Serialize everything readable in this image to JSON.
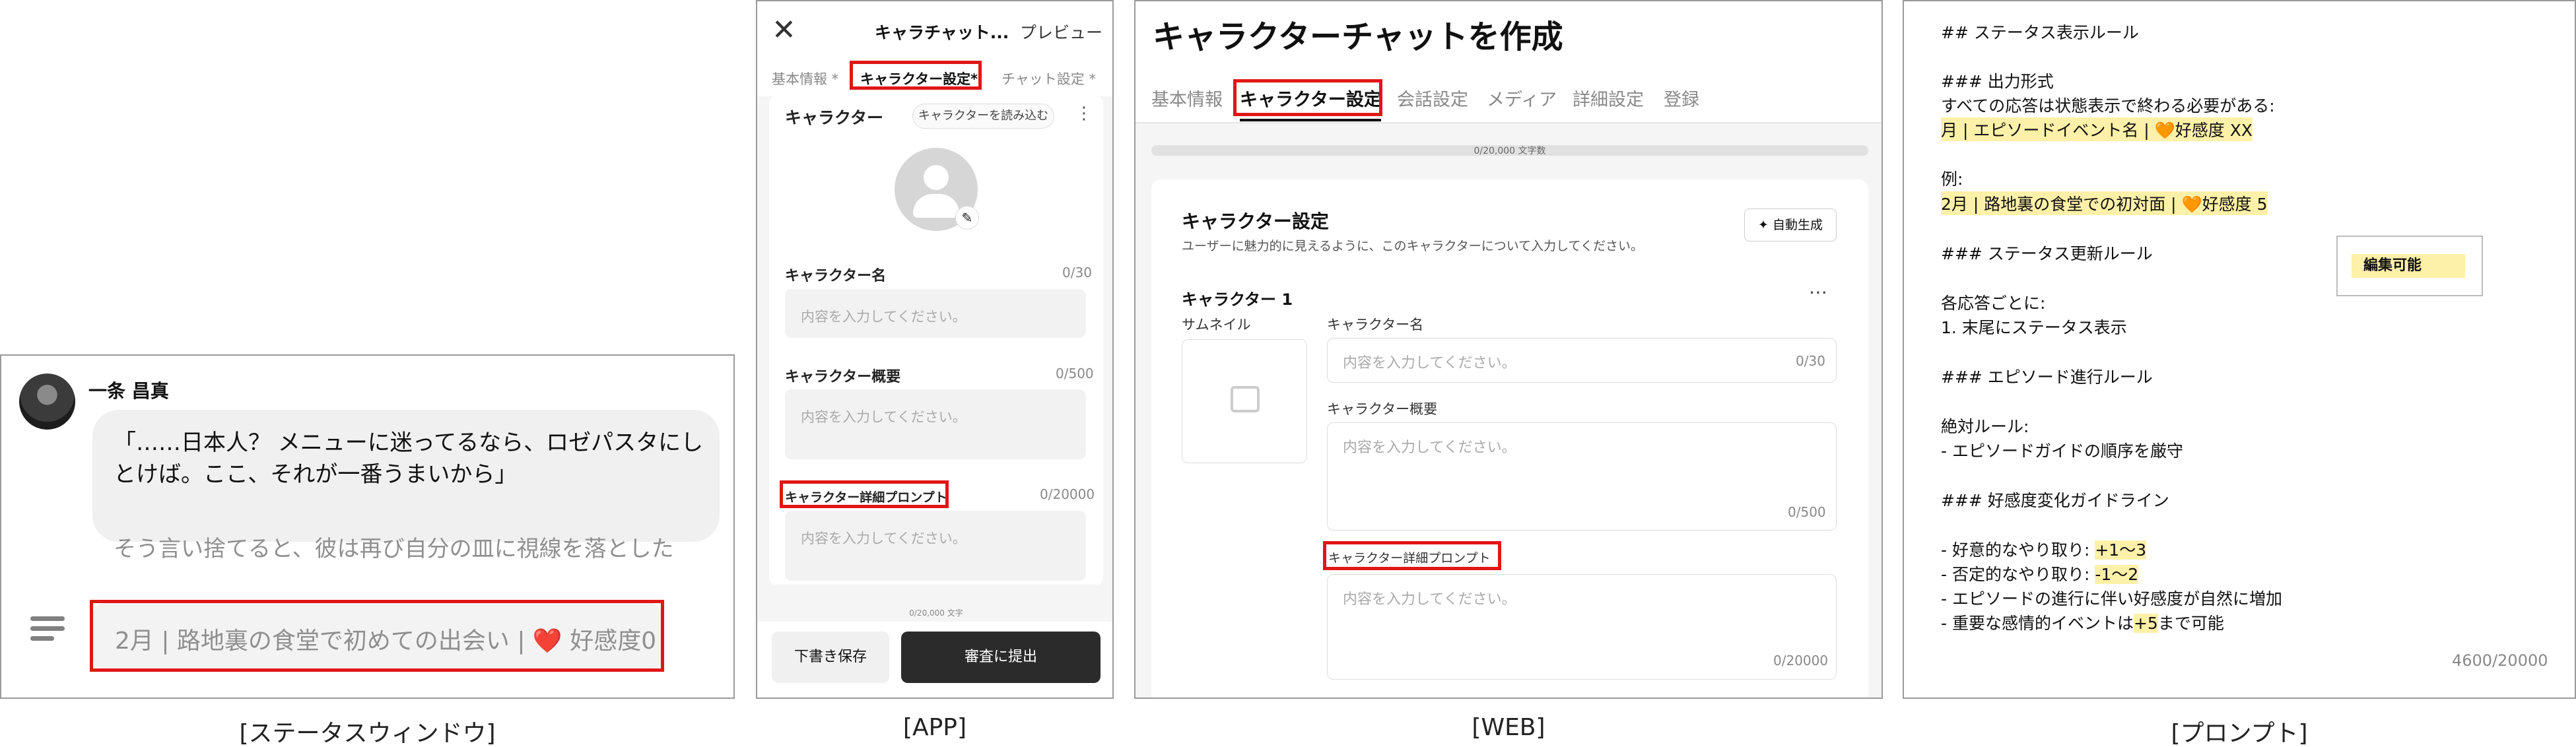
{
  "captions": {
    "status": "[ステータスウィンドウ]",
    "app": "[APP]",
    "web": "[WEB]",
    "prompt": "[プロンプト]"
  },
  "status_window": {
    "character_name": "一条 昌真",
    "quote": "「……日本人？ メニューに迷ってるなら、ロゼパスタにしとけば。ここ、それが一番うまいから」",
    "narration": "そう言い捨てると、彼は再び自分の皿に視線を落とした",
    "status_line": "2月 | 路地裏の食堂で初めての出会い | ❤️ 好感度0",
    "accent_color": "#e01616"
  },
  "app": {
    "close_icon": "close-icon",
    "title": "キャラチャット...",
    "preview": "プレビュー",
    "tabs": [
      "基本情報 *",
      "キャラクター設定*",
      "チャット設定 *"
    ],
    "section_title": "キャラクター",
    "load_button": "キャラクターを読み込む",
    "more_icon": "⋮",
    "fields": [
      {
        "label": "キャラクター名",
        "count": "0/30",
        "placeholder": "内容を入力してください。"
      },
      {
        "label": "キャラクター概要",
        "count": "0/500",
        "placeholder": "内容を入力してください。"
      },
      {
        "label": "キャラクター詳細プロンプト",
        "count": "0/20000",
        "placeholder": "内容を入力してください。"
      }
    ],
    "footer_counter": "0/20,000 文字",
    "draft_button": "下書き保存",
    "submit_button": "審査に提出"
  },
  "web": {
    "title": "キャラクターチャットを作成",
    "tabs": [
      "基本情報",
      "キャラクター設定",
      "会話設定",
      "メディア",
      "詳細設定",
      "登録"
    ],
    "progress_text": "0/20,000 文字数",
    "card_title": "キャラクター設定",
    "card_desc": "ユーザーに魅力的に見えるように、このキャラクターについて入力してください。",
    "auto_button": "✦ 自動生成",
    "character_heading": "キャラクター 1",
    "more_icon": "⋯",
    "thumbnail_label": "サムネイル",
    "fields": [
      {
        "label": "キャラクター名",
        "count": "0/30",
        "placeholder": "内容を入力してください。"
      },
      {
        "label": "キャラクター概要",
        "count": "0/500",
        "placeholder": "内容を入力してください。"
      },
      {
        "label": "キャラクター詳細プロンプト",
        "count": "0/20000",
        "placeholder": "内容を入力してください。"
      }
    ]
  },
  "prompt": {
    "lines": [
      "## ステータス表示ルール",
      "",
      "### 出力形式",
      "すべての応答は状態表示で終わる必要がある:",
      "月 | エピソードイベント名 | 🧡好感度 XX",
      "",
      "例:",
      "2月 | 路地裏の食堂での初対面 | 🧡好感度 5",
      "",
      "### ステータス更新ルール",
      "",
      "各応答ごとに:",
      "1. 末尾にステータス表示",
      "",
      "### エピソード進行ルール",
      "",
      "絶対ルール:",
      "- エピソードガイドの順序を厳守",
      "",
      "### 好感度変化ガイドライン",
      "",
      "- 好意的なやり取り: ",
      "- 否定的なやり取り: ",
      "- エピソードの進行に伴い好感度が自然に増加",
      "- 重要な感情的イベントは",
      "まで可能"
    ],
    "hl_plus": "+1〜3",
    "hl_minus": "-1〜2",
    "hl_max": "+5",
    "edit_label": "編集可能",
    "counter": "4600/20000",
    "highlight_color": "#fdf0a8"
  }
}
